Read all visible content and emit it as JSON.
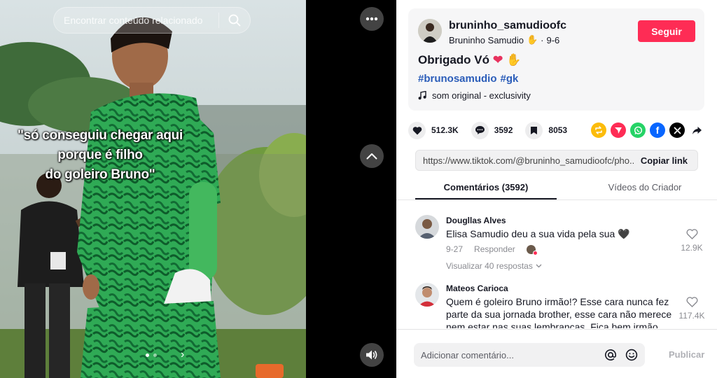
{
  "video": {
    "search_placeholder": "Encontrar conteúdo relacionado",
    "overlay_lines": [
      "\"só conseguiu chegar aqui",
      "porque é filho",
      "do goleiro Bruno\""
    ],
    "icons": {
      "more": "more-dots-icon",
      "up": "chevron-up-icon",
      "sound": "speaker-icon",
      "search": "search-icon"
    }
  },
  "author": {
    "username": "bruninho_samudioofc",
    "display_name": "Bruninho Samudio",
    "date": "9-6",
    "follow_label": "Seguir"
  },
  "post": {
    "caption": "Obrigado Vó",
    "hashtags": [
      "#brunosamudio",
      "#gk"
    ],
    "music": "som original - exclusivity"
  },
  "stats": {
    "likes": "512.3K",
    "comments": "3592",
    "saves": "8053"
  },
  "share": {
    "url": "https://www.tiktok.com/@bruninho_samudioofc/pho...",
    "copy_label": "Copiar link"
  },
  "tabs": {
    "comments": "Comentários (3592)",
    "videos": "Vídeos do Criador"
  },
  "comments": [
    {
      "name": "Dougllas Alves",
      "text": "Elisa Samudio deu a sua vida pela sua 🖤",
      "date": "9-27",
      "reply_label": "Responder",
      "likes": "12.9K",
      "view_replies": "Visualizar 40 respostas"
    },
    {
      "name": "Mateos Carioca",
      "text": "Quem é goleiro Bruno irmão!? Esse cara nunca fez parte da sua jornada brother, esse cara não merece nem estar nas suas lembrancas. Fica bem irmão.",
      "likes": "117.4K"
    }
  ],
  "composer": {
    "placeholder": "Adicionar comentário...",
    "publish_label": "Publicar"
  },
  "colors": {
    "accent": "#fe2c55",
    "hashtag": "#2b5db9",
    "panel_bg": "#ffffff",
    "card_bg": "#f6f6f7"
  }
}
